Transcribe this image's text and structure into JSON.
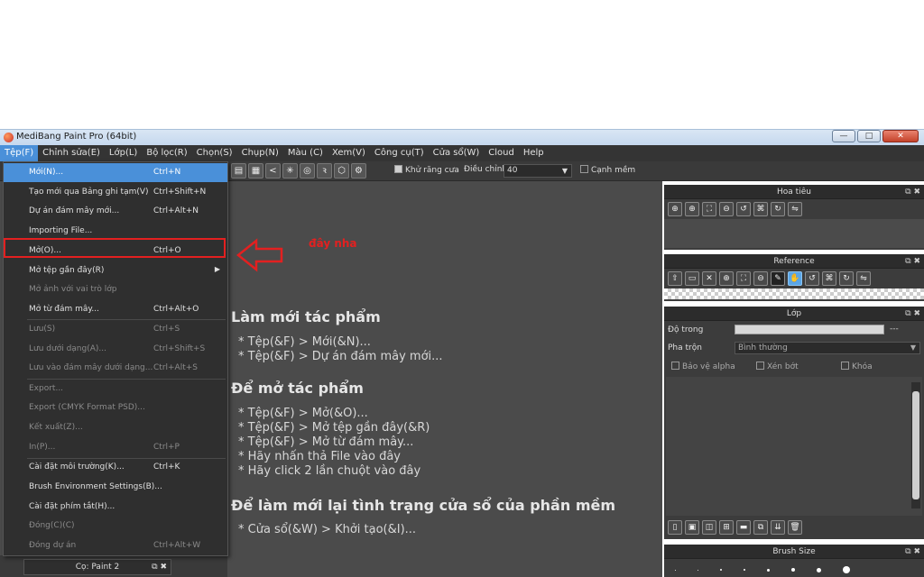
{
  "window": {
    "title": "MediBang Paint Pro (64bit)",
    "minimize": "—",
    "maximize": "□",
    "close": "✕"
  },
  "menubar": [
    {
      "label": "Tệp(F)"
    },
    {
      "label": "Chỉnh sửa(E)"
    },
    {
      "label": "Lớp(L)"
    },
    {
      "label": "Bộ lọc(R)"
    },
    {
      "label": "Chọn(S)"
    },
    {
      "label": "Chụp(N)"
    },
    {
      "label": "Màu (C)"
    },
    {
      "label": "Xem(V)"
    },
    {
      "label": "Công cụ(T)"
    },
    {
      "label": "Cửa sổ(W)"
    },
    {
      "label": "Cloud"
    },
    {
      "label": "Help"
    }
  ],
  "toolbar": {
    "antialias_label": "Khử răng cưa",
    "adjust_label": "Điều chỉnh",
    "adjust_value": "40",
    "edge_label": "Cạnh mềm"
  },
  "file_menu": [
    {
      "label": "Mới(N)...",
      "shortcut": "Ctrl+N",
      "state": "highlight"
    },
    {
      "label": "Tạo mới qua Bảng ghi tạm(V)",
      "shortcut": "Ctrl+Shift+N",
      "state": "normal"
    },
    {
      "label": "Dự án đám mây mới...",
      "shortcut": "Ctrl+Alt+N",
      "state": "normal"
    },
    {
      "label": "Importing File...",
      "shortcut": "",
      "state": "normal"
    },
    {
      "label": "Mở(O)...",
      "shortcut": "Ctrl+O",
      "state": "normal"
    },
    {
      "label": "Mở tệp gần đây(R)",
      "shortcut": "",
      "state": "normal",
      "submenu": "▶"
    },
    {
      "label": "Mở ảnh với vai trò lớp",
      "shortcut": "",
      "state": "disabled"
    },
    {
      "label": "Mở từ đám mây...",
      "shortcut": "Ctrl+Alt+O",
      "state": "normal"
    },
    {
      "label": "Lưu(S)",
      "shortcut": "Ctrl+S",
      "state": "disabled"
    },
    {
      "label": "Lưu dưới dạng(A)...",
      "shortcut": "Ctrl+Shift+S",
      "state": "disabled"
    },
    {
      "label": "Lưu vào đám mây dưới dạng...",
      "shortcut": "Ctrl+Alt+S",
      "state": "disabled"
    },
    {
      "label": "Export...",
      "shortcut": "",
      "state": "disabled"
    },
    {
      "label": "Export (CMYK Format PSD)...",
      "shortcut": "",
      "state": "disabled"
    },
    {
      "label": "Kết xuất(Z)...",
      "shortcut": "",
      "state": "disabled"
    },
    {
      "label": "In(P)...",
      "shortcut": "Ctrl+P",
      "state": "disabled"
    },
    {
      "label": "Cài đặt môi trường(K)...",
      "shortcut": "Ctrl+K",
      "state": "normal"
    },
    {
      "label": "Brush Environment Settings(B)...",
      "shortcut": "",
      "state": "normal"
    },
    {
      "label": "Cài đặt phím tắt(H)...",
      "shortcut": "",
      "state": "normal"
    },
    {
      "label": "Đóng(C)(C)",
      "shortcut": "",
      "state": "disabled"
    },
    {
      "label": "Đóng dự án",
      "shortcut": "Ctrl+Alt+W",
      "state": "disabled"
    }
  ],
  "annotation": {
    "note": "đây nha",
    "color": "#e32020"
  },
  "help": {
    "new_title": "Làm mới tác phẩm",
    "new_lines": [
      "* Tệp(&F) > Mới(&N)...",
      "* Tệp(&F) > Dự án đám mây mới..."
    ],
    "open_title": "Để mở tác phẩm",
    "open_lines": [
      "* Tệp(&F) > Mở(&O)...",
      "* Tệp(&F) > Mở tệp gần đây(&R)",
      "* Tệp(&F) > Mở từ đám mây...",
      "* Hãy nhấn thả File vào đây",
      "* Hãy click 2 lần chuột vào đây"
    ],
    "reset_title": "Để làm mới lại tình trạng cửa sổ của phần mềm",
    "reset_lines": [
      "* Cửa sổ(&W) > Khởi tạo(&I)..."
    ]
  },
  "brush_tab": {
    "label": "Cọ: Paint 2"
  },
  "panels": {
    "navigator": {
      "title": "Hoa tiêu"
    },
    "reference": {
      "title": "Reference"
    },
    "layer": {
      "title": "Lớp",
      "opacity_label": "Độ trong",
      "opacity_value": "---",
      "blend_label": "Pha trộn",
      "blend_value": "Bình thường",
      "protect_alpha": "Bảo vệ alpha",
      "clipping": "Xén bớt",
      "lock": "Khóa"
    },
    "brush_size": {
      "title": "Brush Size"
    }
  }
}
